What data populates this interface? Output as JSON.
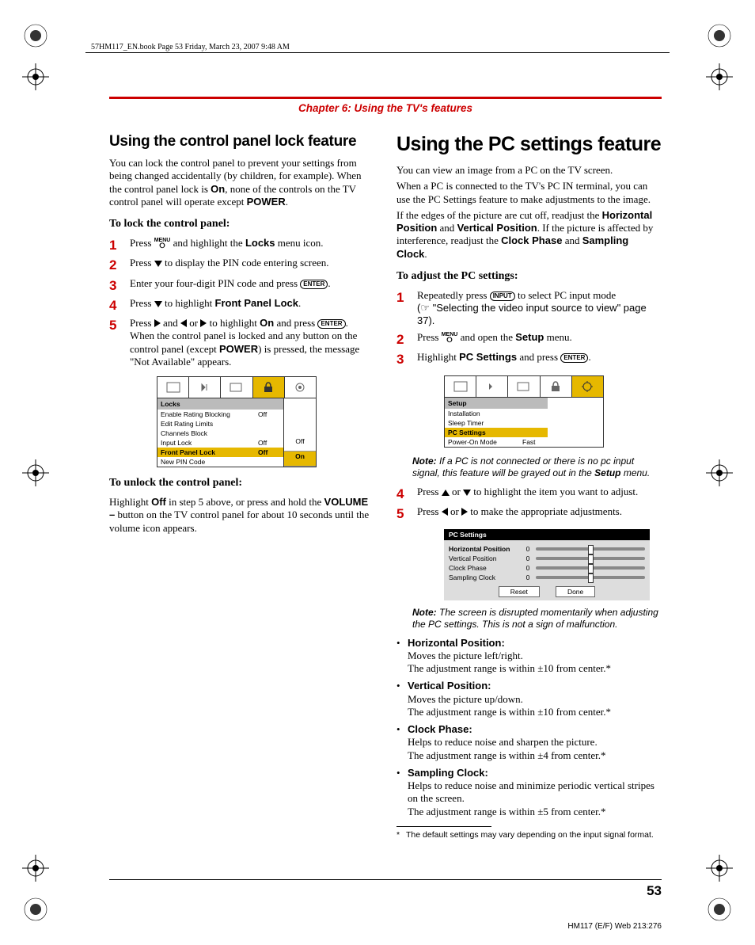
{
  "header_line": "57HM117_EN.book  Page 53  Friday, March 23, 2007  9:48 AM",
  "chapter": "Chapter 6: Using the TV's features",
  "left": {
    "h2": "Using the control panel lock feature",
    "intro": "You can lock the control panel to prevent your settings from being changed accidentally (by children, for example). When the control panel lock is ",
    "intro_on": "On",
    "intro_tail": ", none of the controls on the TV control panel will operate except ",
    "intro_power": "POWER",
    "intro_period": ".",
    "sub1": "To lock the control panel:",
    "s1a": "Press ",
    "s1b": " and highlight the ",
    "s1c": "Locks",
    "s1d": " menu icon.",
    "s2a": "Press ",
    "s2b": " to display the PIN code entering screen.",
    "s3a": "Enter your four-digit PIN code and press ",
    "s3b": ".",
    "s4a": "Press ",
    "s4b": " to highlight ",
    "s4c": "Front Panel Lock",
    "s4d": ".",
    "s5a": "Press ",
    "s5b": " and ",
    "s5c": " or ",
    "s5d": " to highlight ",
    "s5e": "On",
    "s5f": " and press ",
    "s5g": ". When the control panel is locked and any button on the control panel (except ",
    "s5h": "POWER",
    "s5i": ") is pressed, the message \"Not Available\" appears.",
    "osd1": {
      "head": "Locks",
      "r1k": "Enable Rating Blocking",
      "r1v": "Off",
      "r2k": "Edit Rating Limits",
      "r3k": "Channels Block",
      "r4k": "Input Lock",
      "r4v": "Off",
      "r5k": "Front Panel Lock",
      "r5v": "Off",
      "r6k": "New PIN Code",
      "sideTop": "Off",
      "sideBot": "On"
    },
    "sub2": "To unlock the control panel:",
    "unlock_a": "Highlight ",
    "unlock_off": "Off",
    "unlock_b": " in step 5 above, or press and hold the ",
    "unlock_vol": "VOLUME –",
    "unlock_c": " button on the TV control panel for about 10 seconds until the volume icon appears."
  },
  "right": {
    "h1": "Using the PC settings feature",
    "p1": "You can view an image from a PC on the TV screen.",
    "p2": "When a PC is connected to the TV's PC IN terminal, you can use the PC Settings feature to make adjustments to the image.",
    "p3a": "If the edges of the picture are cut off, readjust the ",
    "p3b": "Horizontal Position",
    "p3c": " and ",
    "p3d": "Vertical Position",
    "p3e": ". If the picture is affected by interference, readjust the ",
    "p3f": "Clock Phase",
    "p3g": " and ",
    "p3h": "Sampling Clock",
    "p3i": ".",
    "sub": "To adjust the PC settings:",
    "s1a": "Repeatedly press ",
    "s1b": " to select PC input mode",
    "s1c": "(☞ \"Selecting the video input source to view\" page 37).",
    "s2a": "Press ",
    "s2b": " and open the ",
    "s2c": "Setup",
    "s2d": " menu.",
    "s3a": "Highlight ",
    "s3b": "PC Settings",
    "s3c": " and press ",
    "s3d": ".",
    "osd2": {
      "head": "Setup",
      "r1": "Installation",
      "r2": "Sleep Timer",
      "r3": "PC Settings",
      "r4k": "Power-On Mode",
      "r4v": "Fast"
    },
    "note1a": "Note:",
    "note1b": " If a PC is not connected or there is no pc input signal, this feature will be grayed out in the ",
    "note1c": "Setup",
    "note1d": " menu.",
    "s4a": "Press ",
    "s4b": " or ",
    "s4c": " to highlight the item you want to adjust.",
    "s5a": "Press ",
    "s5b": " or ",
    "s5c": " to make the appropriate adjustments.",
    "osd3": {
      "title": "PC Settings",
      "r1": "Horizontal Position",
      "r2": "Vertical Position",
      "r3": "Clock Phase",
      "r4": "Sampling Clock",
      "zero": "0",
      "reset": "Reset",
      "done": "Done"
    },
    "note2a": "Note:",
    "note2b": " The screen is disrupted momentarily when adjusting the PC settings. This is not a sign of malfunction.",
    "b1t": "Horizontal Position:",
    "b1a": "Moves the picture left/right.",
    "b1b": "The adjustment range is within ±10 from center.*",
    "b2t": "Vertical Position:",
    "b2a": "Moves the picture up/down.",
    "b2b": "The adjustment range is within ±10 from center.*",
    "b3t": "Clock Phase:",
    "b3a": "Helps to reduce noise and sharpen the picture.",
    "b3b": "The adjustment range is within ±4 from center.*",
    "b4t": "Sampling Clock:",
    "b4a": "Helps to reduce noise and minimize periodic vertical stripes on the screen.",
    "b4b": "The adjustment range is within ±5 from center.*",
    "foot": "The default settings may vary depending on the input signal format."
  },
  "page_number": "53",
  "footer_code": "HM117 (E/F) Web 213:276",
  "icons": {
    "menu": "MENU",
    "enter": "ENTER",
    "input": "INPUT"
  }
}
